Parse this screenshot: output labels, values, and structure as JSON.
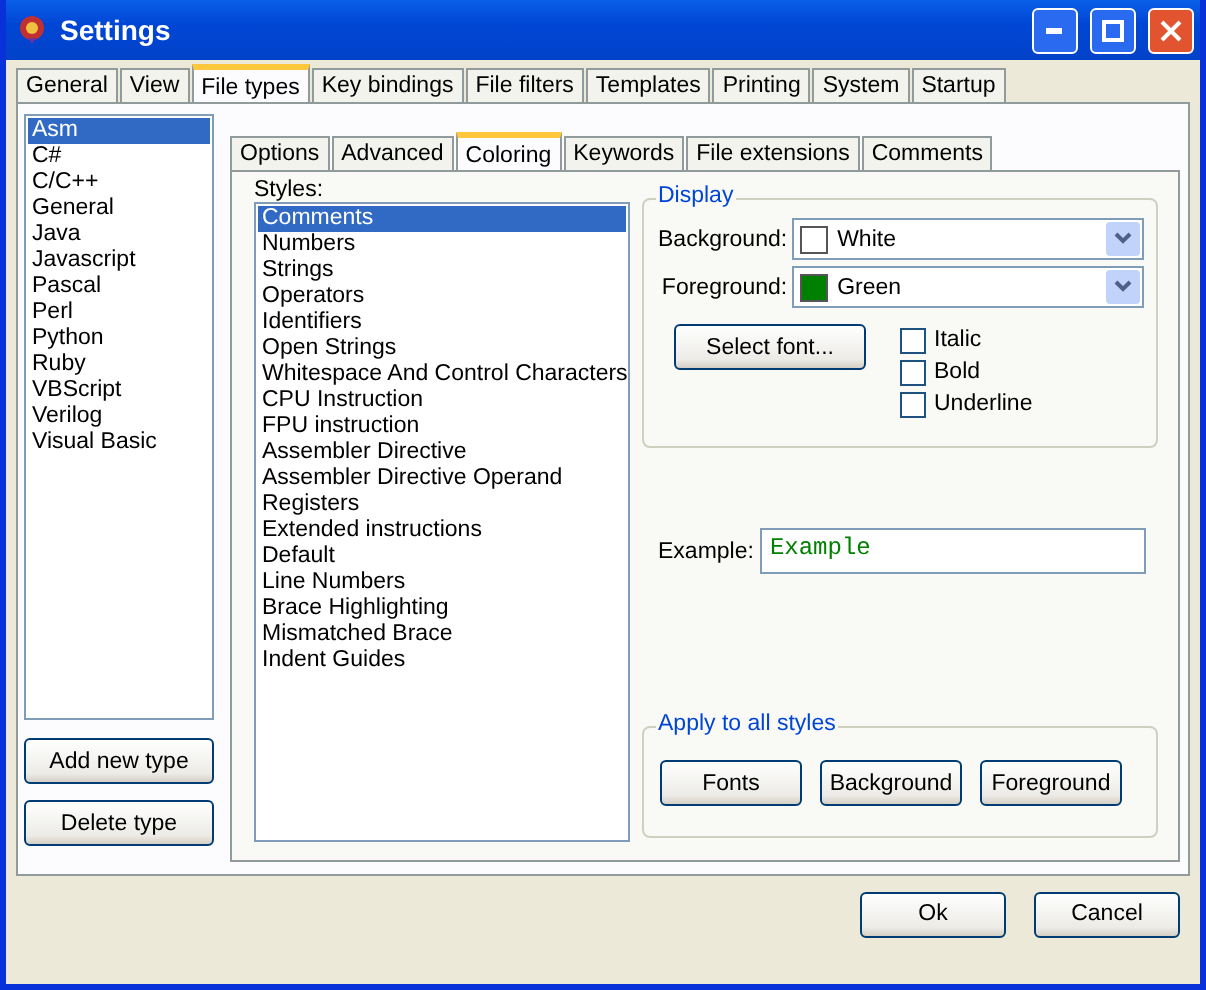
{
  "window": {
    "title": "Settings"
  },
  "main_tabs": [
    {
      "label": "General",
      "selected": false
    },
    {
      "label": "View",
      "selected": false
    },
    {
      "label": "File types",
      "selected": true
    },
    {
      "label": "Key bindings",
      "selected": false
    },
    {
      "label": "File filters",
      "selected": false
    },
    {
      "label": "Templates",
      "selected": false
    },
    {
      "label": "Printing",
      "selected": false
    },
    {
      "label": "System",
      "selected": false
    },
    {
      "label": "Startup",
      "selected": false
    }
  ],
  "file_types": [
    {
      "label": "Asm",
      "selected": true
    },
    {
      "label": "C#",
      "selected": false
    },
    {
      "label": "C/C++",
      "selected": false
    },
    {
      "label": "General",
      "selected": false
    },
    {
      "label": "Java",
      "selected": false
    },
    {
      "label": "Javascript",
      "selected": false
    },
    {
      "label": "Pascal",
      "selected": false
    },
    {
      "label": "Perl",
      "selected": false
    },
    {
      "label": "Python",
      "selected": false
    },
    {
      "label": "Ruby",
      "selected": false
    },
    {
      "label": "VBScript",
      "selected": false
    },
    {
      "label": "Verilog",
      "selected": false
    },
    {
      "label": "Visual Basic",
      "selected": false
    }
  ],
  "type_buttons": [
    "Add new type",
    "Delete type"
  ],
  "inner_tabs": [
    {
      "label": "Options",
      "selected": false
    },
    {
      "label": "Advanced",
      "selected": false
    },
    {
      "label": "Coloring",
      "selected": true
    },
    {
      "label": "Keywords",
      "selected": false
    },
    {
      "label": "File extensions",
      "selected": false
    },
    {
      "label": "Comments",
      "selected": false
    }
  ],
  "styles_label": "Styles:",
  "styles": [
    {
      "label": "Comments",
      "selected": true
    },
    {
      "label": "Numbers",
      "selected": false
    },
    {
      "label": "Strings",
      "selected": false
    },
    {
      "label": "Operators",
      "selected": false
    },
    {
      "label": "Identifiers",
      "selected": false
    },
    {
      "label": "Open Strings",
      "selected": false
    },
    {
      "label": "Whitespace And Control Characters",
      "selected": false
    },
    {
      "label": "CPU Instruction",
      "selected": false
    },
    {
      "label": "FPU instruction",
      "selected": false
    },
    {
      "label": "Assembler Directive",
      "selected": false
    },
    {
      "label": "Assembler Directive Operand",
      "selected": false
    },
    {
      "label": "Registers",
      "selected": false
    },
    {
      "label": "Extended instructions",
      "selected": false
    },
    {
      "label": "Default",
      "selected": false
    },
    {
      "label": "Line Numbers",
      "selected": false
    },
    {
      "label": "Brace Highlighting",
      "selected": false
    },
    {
      "label": "Mismatched Brace",
      "selected": false
    },
    {
      "label": "Indent Guides",
      "selected": false
    }
  ],
  "display": {
    "title": "Display",
    "colors": [
      {
        "label": "Background:",
        "value": "White",
        "color": "#ffffff"
      },
      {
        "label": "Foreground:",
        "value": "Green",
        "color": "#008000"
      }
    ],
    "select_font": "Select font...",
    "checkboxes": [
      {
        "label": "Italic",
        "checked": false
      },
      {
        "label": "Bold",
        "checked": false
      },
      {
        "label": "Underline",
        "checked": false
      }
    ]
  },
  "example": {
    "label": "Example:",
    "value": "Example"
  },
  "apply_group": {
    "title": "Apply to all styles",
    "buttons": [
      "Fonts",
      "Background",
      "Foreground"
    ]
  },
  "dialog_buttons": [
    "Ok",
    "Cancel"
  ]
}
